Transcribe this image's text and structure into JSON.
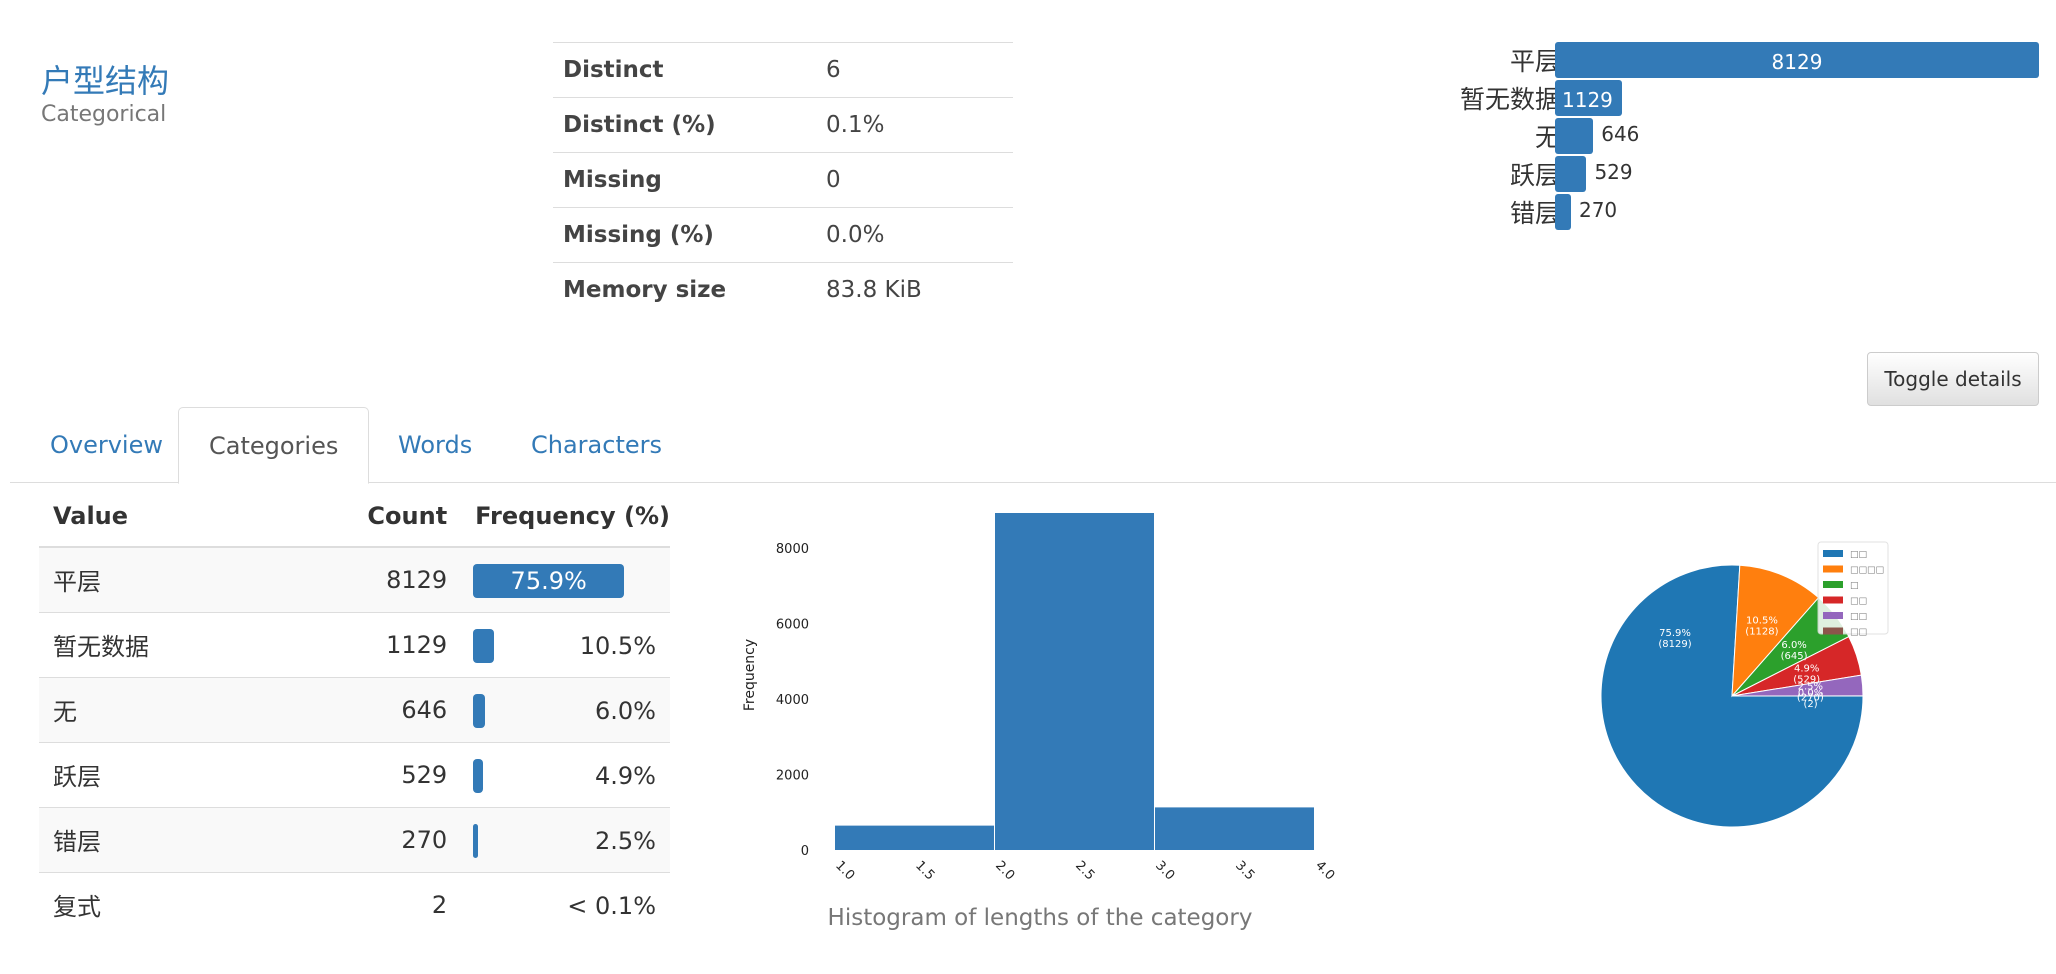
{
  "variable": {
    "name": "户型结构",
    "type": "Categorical"
  },
  "stats": [
    {
      "label": "Distinct",
      "value": "6"
    },
    {
      "label": "Distinct (%)",
      "value": "0.1%"
    },
    {
      "label": "Missing",
      "value": "0"
    },
    {
      "label": "Missing (%)",
      "value": "0.0%"
    },
    {
      "label": "Memory size",
      "value": "83.8 KiB"
    }
  ],
  "mini_bars": [
    {
      "label": "平层",
      "value": "8129",
      "fraction": 1.0
    },
    {
      "label": "暂无数据",
      "value": "1129",
      "fraction": 0.139
    },
    {
      "label": "无",
      "value": "646",
      "fraction": 0.079
    },
    {
      "label": "跃层",
      "value": "529",
      "fraction": 0.065
    },
    {
      "label": "错层",
      "value": "270",
      "fraction": 0.033
    }
  ],
  "toggle_label": "Toggle details",
  "tabs": [
    {
      "label": "Overview",
      "active": false
    },
    {
      "label": "Categories",
      "active": true
    },
    {
      "label": "Words",
      "active": false
    },
    {
      "label": "Characters",
      "active": false
    }
  ],
  "freq_table": {
    "headers": {
      "value": "Value",
      "count": "Count",
      "frequency": "Frequency (%)"
    },
    "rows": [
      {
        "value": "平层",
        "count": "8129",
        "freq": "75.9%",
        "fraction": 0.759
      },
      {
        "value": "暂无数据",
        "count": "1129",
        "freq": "10.5%",
        "fraction": 0.105
      },
      {
        "value": "无",
        "count": "646",
        "freq": "6.0%",
        "fraction": 0.06
      },
      {
        "value": "跃层",
        "count": "529",
        "freq": "4.9%",
        "fraction": 0.049
      },
      {
        "value": "错层",
        "count": "270",
        "freq": "2.5%",
        "fraction": 0.025
      },
      {
        "value": "复式",
        "count": "2",
        "freq": "< 0.1%",
        "fraction": 0.0
      }
    ]
  },
  "colors": {
    "accent": "#337ab7"
  },
  "chart_data": [
    {
      "type": "bar",
      "title": "",
      "caption": "Histogram of lengths of the category",
      "xlabel": "",
      "ylabel": "Frequency",
      "bins": [
        [
          1.0,
          2.0
        ],
        [
          2.0,
          3.0
        ],
        [
          3.0,
          4.0
        ]
      ],
      "values": [
        646,
        8931,
        1129
      ],
      "xticks": [
        "1.0",
        "1.5",
        "2.0",
        "2.5",
        "3.0",
        "3.5",
        "4.0"
      ],
      "yticks": [
        "0",
        "2000",
        "4000",
        "6000",
        "8000"
      ],
      "xlim": [
        1.0,
        4.0
      ],
      "ylim": [
        0,
        8931
      ],
      "color": "#337ab7"
    },
    {
      "type": "pie",
      "slices": [
        {
          "label": "□□",
          "value": 8129,
          "text": "75.9%",
          "count": "(8129)",
          "color": "#1f77b4"
        },
        {
          "label": "□□□□",
          "value": 1128,
          "text": "10.5%",
          "count": "(1128)",
          "color": "#ff7f0e"
        },
        {
          "label": "□",
          "value": 645,
          "text": "6.0%",
          "count": "(645)",
          "color": "#2ca02c"
        },
        {
          "label": "□□",
          "value": 529,
          "text": "4.9%",
          "count": "(529)",
          "color": "#d62728"
        },
        {
          "label": "□□",
          "value": 270,
          "text": "2.5%",
          "count": "(270)",
          "color": "#9467bd"
        },
        {
          "label": "□□",
          "value": 2,
          "text": "0.0%",
          "count": "(2)",
          "color": "#8c564b"
        }
      ],
      "legend": "top-right"
    }
  ]
}
